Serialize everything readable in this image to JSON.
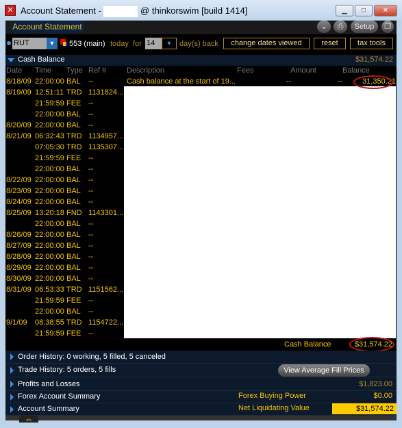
{
  "window": {
    "title_prefix": "Account Statement - ",
    "title_suffix": "@ thinkorswim [build 1414]",
    "min": "▁",
    "max": "□",
    "close": "✕"
  },
  "header": {
    "tab": "Account Statement",
    "setup": "Setup"
  },
  "toolbar": {
    "symbol": "RUT",
    "account": "553 (main)",
    "today": "today",
    "for": "for",
    "days": "14",
    "days_back": "day(s) back",
    "change_dates": "change dates viewed",
    "reset": "reset",
    "tax_tools": "tax tools"
  },
  "cash": {
    "title": "Cash Balance",
    "total": "$31,574.22",
    "columns": [
      "Date",
      "Time",
      "Type",
      "Ref #",
      "Description",
      "Fees",
      "Amount",
      "Balance"
    ],
    "rows": [
      {
        "date": "8/18/09",
        "time": "22:00:00",
        "type": "BAL",
        "ref": "--",
        "desc": "Cash balance at the start of 19...",
        "fees": "--",
        "amount": "--",
        "balance": "31,350.21"
      },
      {
        "date": "8/19/09",
        "time": "12:51:11",
        "type": "TRD",
        "ref": "1131824..."
      },
      {
        "date": "",
        "time": "21:59:59",
        "type": "FEE",
        "ref": "--"
      },
      {
        "date": "",
        "time": "22:00:00",
        "type": "BAL",
        "ref": "--"
      },
      {
        "date": "8/20/09",
        "time": "22:00:00",
        "type": "BAL",
        "ref": "--"
      },
      {
        "date": "8/21/09",
        "time": "06:32:43",
        "type": "TRD",
        "ref": "1134957..."
      },
      {
        "date": "",
        "time": "07:05:30",
        "type": "TRD",
        "ref": "1135307..."
      },
      {
        "date": "",
        "time": "21:59:59",
        "type": "FEE",
        "ref": "--"
      },
      {
        "date": "",
        "time": "22:00:00",
        "type": "BAL",
        "ref": "--"
      },
      {
        "date": "8/22/09",
        "time": "22:00:00",
        "type": "BAL",
        "ref": "--"
      },
      {
        "date": "8/23/09",
        "time": "22:00:00",
        "type": "BAL",
        "ref": "--"
      },
      {
        "date": "8/24/09",
        "time": "22:00:00",
        "type": "BAL",
        "ref": "--"
      },
      {
        "date": "8/25/09",
        "time": "13:20:18",
        "type": "FND",
        "ref": "1143301..."
      },
      {
        "date": "",
        "time": "22:00:00",
        "type": "BAL",
        "ref": "--"
      },
      {
        "date": "8/26/09",
        "time": "22:00:00",
        "type": "BAL",
        "ref": "--"
      },
      {
        "date": "8/27/09",
        "time": "22:00:00",
        "type": "BAL",
        "ref": "--"
      },
      {
        "date": "8/28/09",
        "time": "22:00:00",
        "type": "BAL",
        "ref": "--"
      },
      {
        "date": "8/29/09",
        "time": "22:00:00",
        "type": "BAL",
        "ref": "--"
      },
      {
        "date": "8/30/09",
        "time": "22:00:00",
        "type": "BAL",
        "ref": "--"
      },
      {
        "date": "8/31/09",
        "time": "06:53:33",
        "type": "TRD",
        "ref": "1151562..."
      },
      {
        "date": "",
        "time": "21:59:59",
        "type": "FEE",
        "ref": "--"
      },
      {
        "date": "",
        "time": "22:00:00",
        "type": "BAL",
        "ref": "--"
      },
      {
        "date": "9/1/09",
        "time": "08:38:55",
        "type": "TRD",
        "ref": "1154722..."
      },
      {
        "date": "",
        "time": "21:59:59",
        "type": "FEE",
        "ref": "--"
      }
    ],
    "footer_label": "Cash Balance",
    "footer_value": "$31,574.22"
  },
  "sections": {
    "order_history": "Order History: 0 working, 5 filled, 5 canceled",
    "trade_history": "Trade History: 5 orders, 5 fills",
    "view_avg": "View Average Fill Prices",
    "pnl": "Profits and Losses",
    "pnl_value": "$1,823.00",
    "forex": "Forex Account Summary",
    "forex_label": "Forex Buying Power",
    "forex_value": "$0.00",
    "account": "Account Summary",
    "nlv_label": "Net Liquidating Value",
    "nlv_value": "$31,574.22"
  },
  "colors": {
    "accent": "#f5c400",
    "highlight": "#ffcc00",
    "annotation": "#c01818"
  }
}
